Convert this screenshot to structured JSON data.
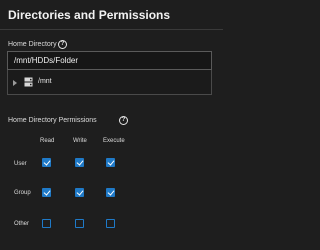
{
  "header": {
    "title": "Directories and Permissions"
  },
  "home_directory": {
    "label": "Home Directory",
    "value": "/mnt/HDDs/Folder",
    "tree_root": "/mnt"
  },
  "permissions": {
    "label": "Home Directory Permissions",
    "columns": [
      "Read",
      "Write",
      "Execute"
    ],
    "rows": [
      {
        "label": "User",
        "read": true,
        "write": true,
        "execute": true
      },
      {
        "label": "Group",
        "read": true,
        "write": true,
        "execute": true
      },
      {
        "label": "Other",
        "read": false,
        "write": false,
        "execute": false
      }
    ]
  },
  "icons": {
    "help": "help-circle-icon",
    "expand": "caret-right-icon",
    "drive": "hard-drive-icon"
  },
  "colors": {
    "accent": "#1f7ac8",
    "background": "#1e1e1e"
  }
}
